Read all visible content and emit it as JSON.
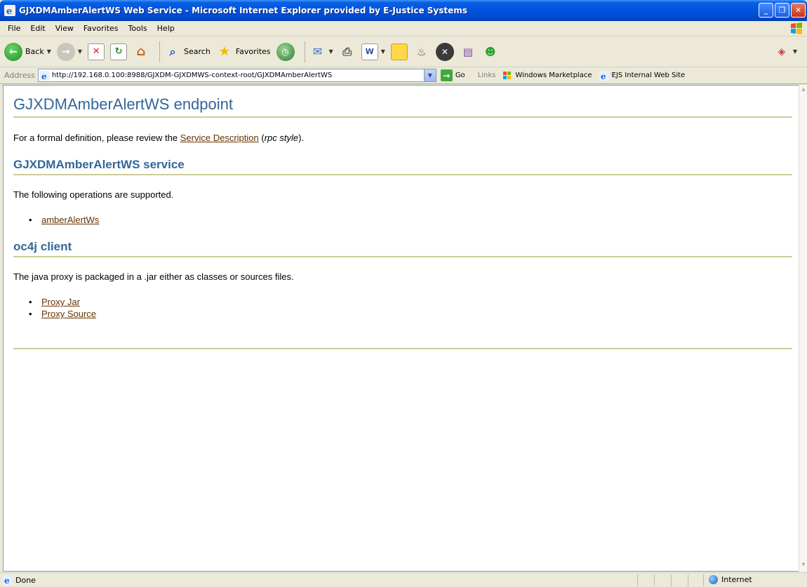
{
  "window": {
    "title": "GJXDMAmberAlertWS Web Service - Microsoft Internet Explorer provided by E-Justice Systems",
    "buttons": {
      "minimize": "_",
      "maximize": "❐",
      "close": "✕"
    }
  },
  "menu": [
    "File",
    "Edit",
    "View",
    "Favorites",
    "Tools",
    "Help"
  ],
  "toolbar": {
    "back_label": "Back",
    "search_label": "Search",
    "favorites_label": "Favorites"
  },
  "address": {
    "label": "Address",
    "url": "http://192.168.0.100:8988/GJXDM-GJXDMWS-context-root/GJXDMAmberAlertWS",
    "go_label": "Go",
    "links_label": "Links",
    "links": [
      "Windows Marketplace",
      "EJS Internal Web Site"
    ]
  },
  "page": {
    "title": "GJXDMAmberAlertWS endpoint",
    "intro_prefix": "For a formal definition, please review the ",
    "service_description_link": "Service Description",
    "intro_paren_open": " (",
    "rpc_style": "rpc style",
    "intro_suffix": ").",
    "service_heading": "GJXDMAmberAlertWS service",
    "operations_text": "The following operations are supported.",
    "operations": [
      "amberAlertWs"
    ],
    "client_heading": "oc4j client",
    "client_text": "The java proxy is packaged in a .jar either as classes or sources files.",
    "client_links": [
      "Proxy Jar",
      "Proxy Source"
    ]
  },
  "status": {
    "text": "Done",
    "zone": "Internet"
  },
  "colors": {
    "heading": "#336699",
    "rule": "#cccc99",
    "link": "#663300",
    "titlebar": "#0053e1"
  }
}
